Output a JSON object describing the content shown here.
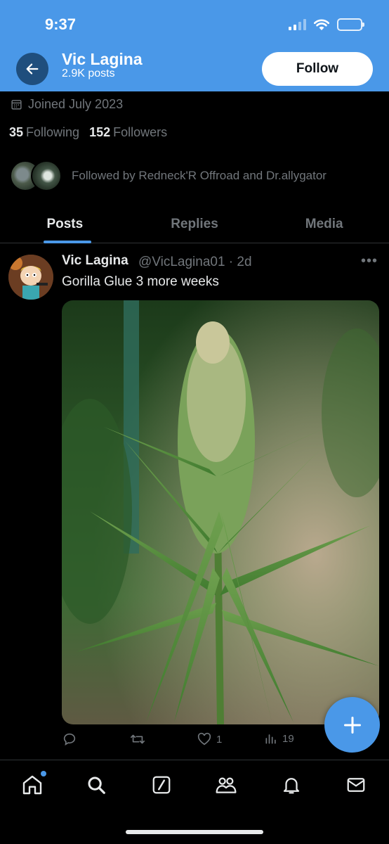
{
  "status_bar": {
    "time": "9:37",
    "icons": [
      "signal-icon",
      "wifi-icon",
      "battery-icon"
    ]
  },
  "header": {
    "name": "Vic Lagina",
    "posts_count": "2.9K posts",
    "follow_label": "Follow",
    "accent_color": "#4a98e8"
  },
  "profile": {
    "joined": "Joined July 2023",
    "following_count": "35",
    "following_label": "Following",
    "followers_count": "152",
    "followers_label": "Followers",
    "followed_by": "Followed by Redneck'R Offroad and Dr.allygator"
  },
  "tabs": [
    {
      "label": "Posts",
      "active": true
    },
    {
      "label": "Replies",
      "active": false
    },
    {
      "label": "Media",
      "active": false
    }
  ],
  "tweet": {
    "author_name": "Vic Lagina",
    "handle_time": "@VicLagina01 · 2d",
    "text": "Gorilla Glue 3 more weeks",
    "more_icon": "more-icon",
    "actions": {
      "reply_count": "",
      "retweet_count": "",
      "like_count": "1",
      "views_count": "19"
    }
  },
  "fab": {
    "icon": "plus-icon"
  },
  "bottom_nav": {
    "items": [
      "home-icon",
      "search-icon",
      "grok-icon",
      "communities-icon",
      "notifications-icon",
      "messages-icon"
    ]
  }
}
